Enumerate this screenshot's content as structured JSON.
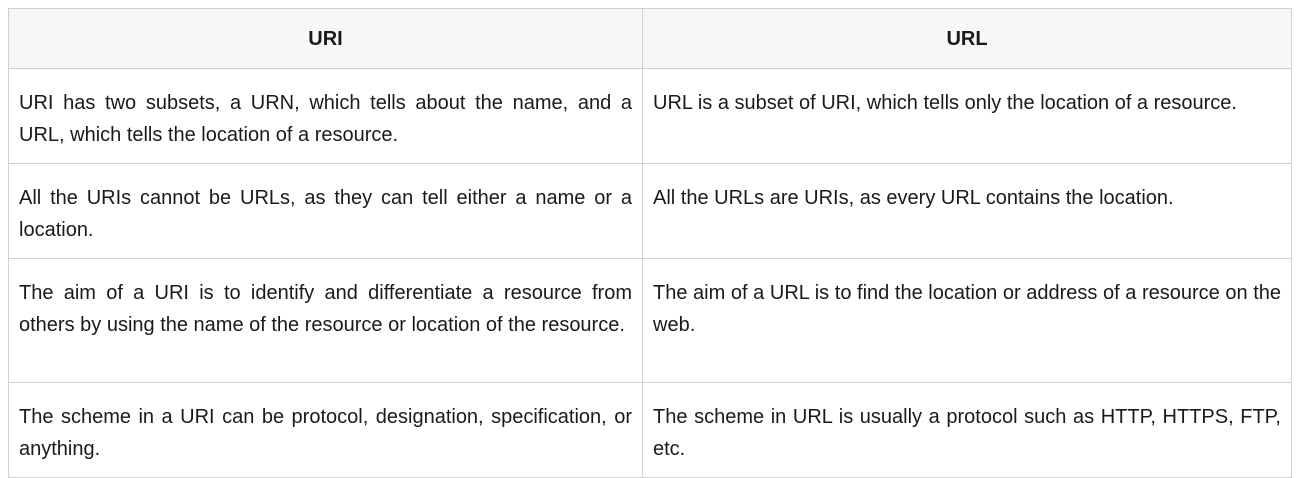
{
  "table": {
    "headers": [
      "URI",
      "URL"
    ],
    "rows": [
      [
        "URI has two subsets, a URN, which tells about the name, and a URL, which tells the location of a resource.",
        "URL is a subset of URI, which tells only the location of a resource."
      ],
      [
        "All the URIs cannot be URLs, as they can tell either a name or a location.",
        "All the URLs are URIs, as every URL contains the location."
      ],
      [
        "The aim of a  URI is to identify and differentiate a resource from others by using the name of the resource or location of the resource.",
        "The aim of a URL is to find the location or address of a resource on the web."
      ],
      [
        "The scheme in a URI can be protocol, designation, specification, or anything.",
        "The scheme in URL is usually a protocol such as HTTP, HTTPS, FTP, etc."
      ]
    ]
  }
}
